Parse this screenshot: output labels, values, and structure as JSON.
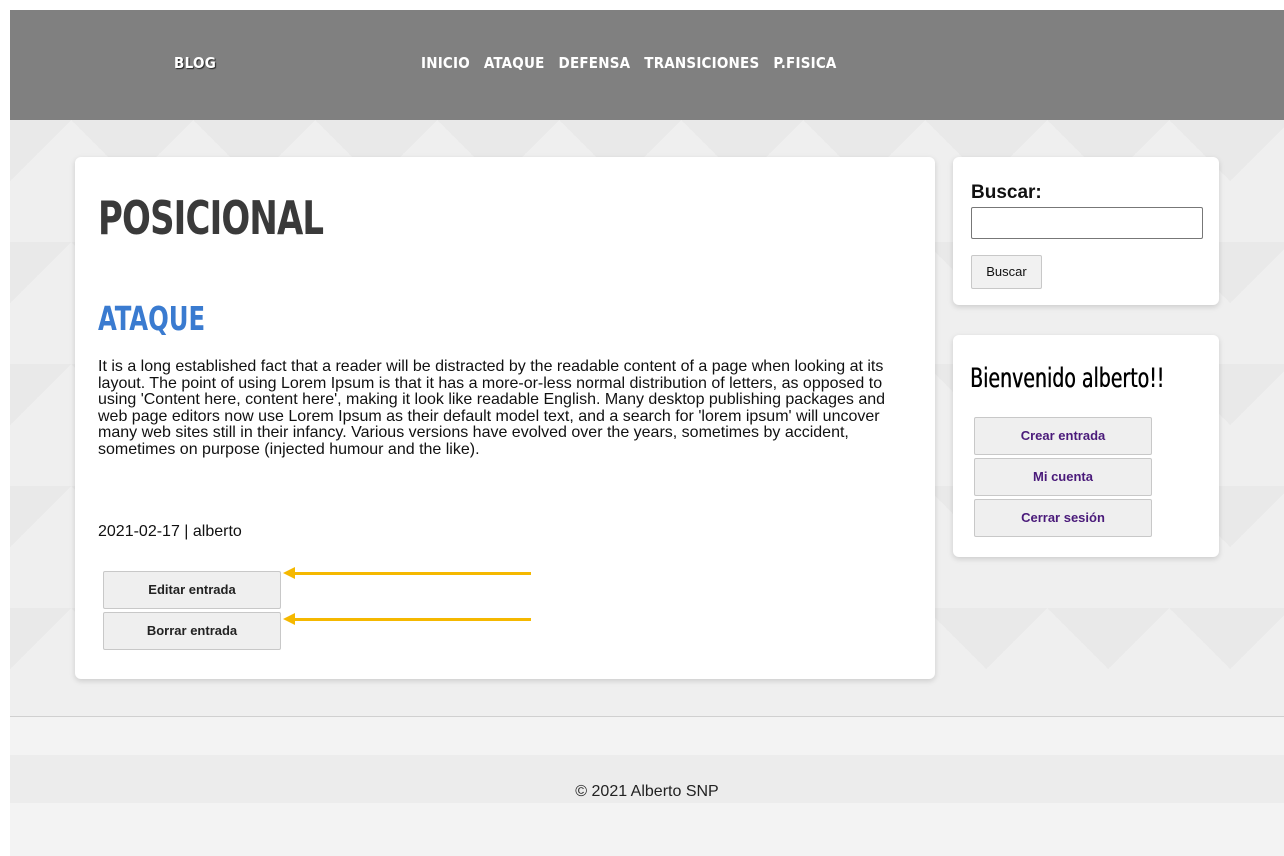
{
  "header": {
    "brand": "BLOG",
    "nav": [
      "INICIO",
      "ATAQUE",
      "DEFENSA",
      "TRANSICIONES",
      "P.FISICA"
    ]
  },
  "main": {
    "page_title": "POSICIONAL",
    "post": {
      "title": "ATAQUE",
      "body": "It is a long established fact that a reader will be distracted by the readable content of a page when looking at its layout. The point of using Lorem Ipsum is that it has a more-or-less normal distribution of letters, as opposed to using 'Content here, content here', making it look like readable English. Many desktop publishing packages and web page editors now use Lorem Ipsum as their default model text, and a search for 'lorem ipsum' will uncover many web sites still in their infancy. Various versions have evolved over the years, sometimes by accident, sometimes on purpose (injected humour and the like).",
      "meta": "2021-02-17 | alberto",
      "edit_label": "Editar entrada",
      "delete_label": "Borrar entrada"
    }
  },
  "sidebar": {
    "search": {
      "label": "Buscar:",
      "value": "",
      "button_label": "Buscar"
    },
    "user": {
      "welcome": "Bienvenido alberto!!",
      "create_label": "Crear entrada",
      "account_label": "Mi cuenta",
      "logout_label": "Cerrar sesión"
    }
  },
  "footer": {
    "copyright": "© 2021 Alberto SNP"
  },
  "colors": {
    "header_bg": "#808080",
    "post_title": "#3a7bd0",
    "arrow": "#f5b800",
    "user_button_text": "#4a1a7a"
  }
}
